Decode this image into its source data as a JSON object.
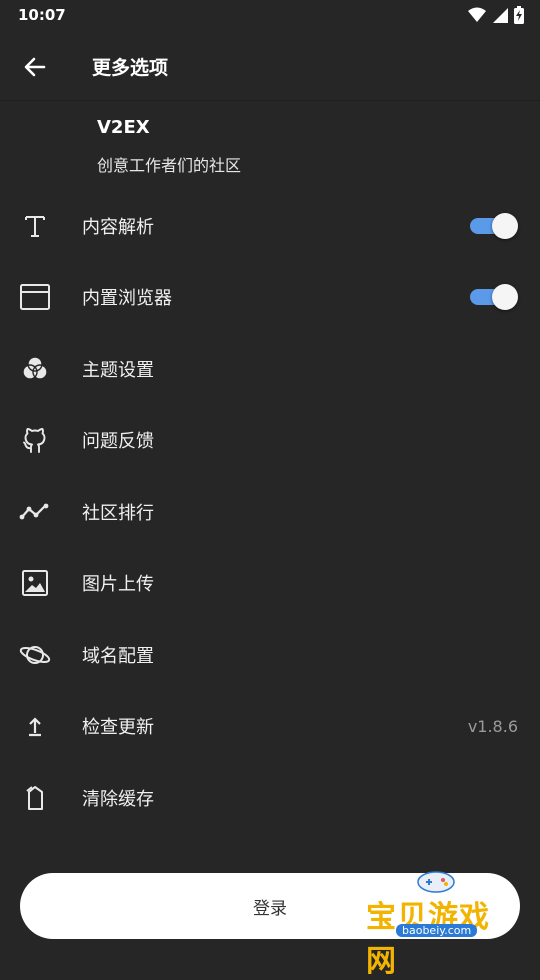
{
  "status_bar": {
    "time": "10:07",
    "icons": [
      "wifi-icon",
      "signal-icon",
      "battery-charging-icon"
    ]
  },
  "app_bar": {
    "back_icon": "arrow-left-icon",
    "title": "更多选项"
  },
  "site": {
    "name": "V2EX",
    "description": "创意工作者们的社区"
  },
  "menu": [
    {
      "icon": "text-t-icon",
      "label": "内容解析",
      "toggle": true
    },
    {
      "icon": "browser-window-icon",
      "label": "内置浏览器",
      "toggle": true
    },
    {
      "icon": "palette-circles-icon",
      "label": "主题设置"
    },
    {
      "icon": "github-icon",
      "label": "问题反馈"
    },
    {
      "icon": "trending-line-icon",
      "label": "社区排行"
    },
    {
      "icon": "image-icon",
      "label": "图片上传"
    },
    {
      "icon": "planet-icon",
      "label": "域名配置"
    },
    {
      "icon": "upload-arrow-icon",
      "label": "检查更新",
      "trailing": "v1.8.6"
    },
    {
      "icon": "clear-cache-icon",
      "label": "清除缓存"
    }
  ],
  "login_button": {
    "label": "登录"
  },
  "watermark": {
    "text": "宝贝游戏网",
    "url": "baobeiy.com"
  },
  "colors": {
    "background": "#262626",
    "toggle_track": "#5a9ae8",
    "toggle_knob": "#f5f5f5",
    "button_bg": "#ffffff"
  }
}
